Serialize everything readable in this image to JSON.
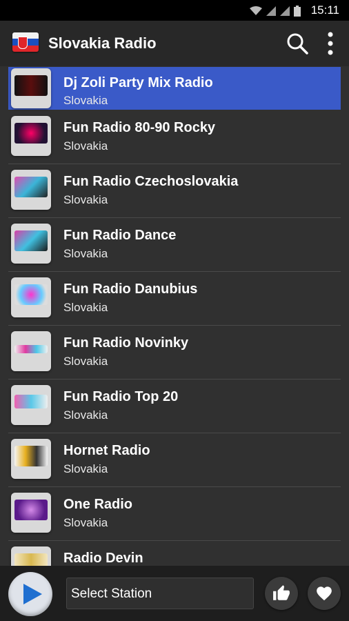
{
  "status_bar": {
    "time": "15:11"
  },
  "app_bar": {
    "title": "Slovakia Radio",
    "icons": [
      "slovakia-flag-icon",
      "search-icon",
      "more-vert-icon"
    ]
  },
  "stations": [
    {
      "name": "Dj Zoli Party Mix Radio",
      "country": "Slovakia",
      "selected": true
    },
    {
      "name": "Fun Radio 80-90 Rocky",
      "country": "Slovakia"
    },
    {
      "name": "Fun Radio Czechoslovakia",
      "country": "Slovakia"
    },
    {
      "name": "Fun Radio Dance",
      "country": "Slovakia"
    },
    {
      "name": "Fun Radio Danubius",
      "country": "Slovakia"
    },
    {
      "name": "Fun Radio Novinky",
      "country": "Slovakia"
    },
    {
      "name": "Fun Radio Top 20",
      "country": "Slovakia"
    },
    {
      "name": "Hornet Radio",
      "country": "Slovakia"
    },
    {
      "name": "One Radio",
      "country": "Slovakia"
    },
    {
      "name": "Radio Devin",
      "country": ""
    }
  ],
  "player": {
    "station_label": "Select Station",
    "icons": [
      "play-icon",
      "thumbs-up-icon",
      "heart-icon"
    ]
  },
  "colors": {
    "selected_row": "#3a5ac8",
    "background": "#303030",
    "app_bar": "#282828"
  }
}
